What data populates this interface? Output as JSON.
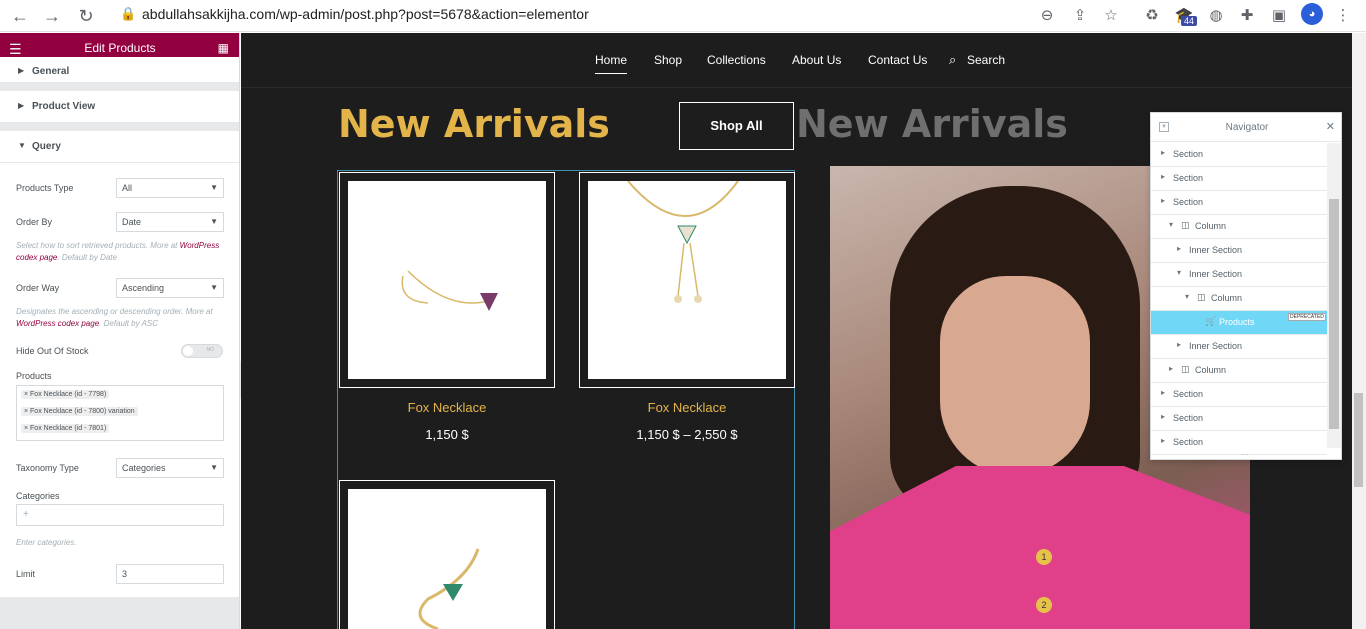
{
  "browser": {
    "url": "abdullahsakkijha.com/wp-admin/post.php?post=5678&action=elementor",
    "badge_count": "44"
  },
  "panel": {
    "title": "Edit Products",
    "sections": {
      "general": "General",
      "product_view": "Product View",
      "query": "Query"
    },
    "products_type_label": "Products Type",
    "products_type_value": "All",
    "order_by_label": "Order By",
    "order_by_value": "Date",
    "order_by_desc_1": "Select how to sort retrieved products. More at",
    "order_by_desc_link": "WordPress codex page",
    "order_by_desc_2": ". Default by Date",
    "order_way_label": "Order Way",
    "order_way_value": "Ascending",
    "order_way_desc_1": "Designates the ascending or descending order. More at",
    "order_way_desc_link": "WordPress codex page",
    "order_way_desc_2": ". Default by ASC",
    "hide_out_of_stock_label": "Hide Out Of Stock",
    "toggle_text": "NO",
    "products_label": "Products",
    "product_tags": [
      "× Fox Necklace (id - 7798)",
      "× Fox Necklace (id - 7800) variation",
      "× Fox Necklace (id - 7801)"
    ],
    "taxonomy_type_label": "Taxonomy Type",
    "taxonomy_type_value": "Categories",
    "categories_label": "Categories",
    "categories_hint": "Enter categories.",
    "limit_label": "Limit",
    "limit_value": "3"
  },
  "site": {
    "menu": [
      "Home",
      "Shop",
      "Collections",
      "About Us",
      "Contact Us",
      "Search"
    ],
    "heading": "New Arrivals",
    "heading_ghost": "New Arrivals",
    "shop_all": "Shop All",
    "products": [
      {
        "name": "Fox Necklace",
        "price": "1,150 $"
      },
      {
        "name": "Fox Necklace",
        "price": "1,150 $ – 2,550 $"
      }
    ],
    "hotspots": [
      "1",
      "2"
    ]
  },
  "navigator": {
    "title": "Navigator",
    "rows": [
      {
        "label": "Section",
        "indent": 0
      },
      {
        "label": "Section",
        "indent": 0
      },
      {
        "label": "Section",
        "indent": 0
      },
      {
        "label": "Column",
        "indent": 1
      },
      {
        "label": "Inner Section",
        "indent": 2
      },
      {
        "label": "Inner Section",
        "indent": 2
      },
      {
        "label": "Column",
        "indent": 3
      },
      {
        "label": "Products",
        "indent": 4
      },
      {
        "label": "Inner Section",
        "indent": 2
      },
      {
        "label": "Column",
        "indent": 1
      },
      {
        "label": "Section",
        "indent": 0
      },
      {
        "label": "Section",
        "indent": 0
      },
      {
        "label": "Section",
        "indent": 0
      }
    ],
    "deprecated_label": "DEPRECATED"
  }
}
